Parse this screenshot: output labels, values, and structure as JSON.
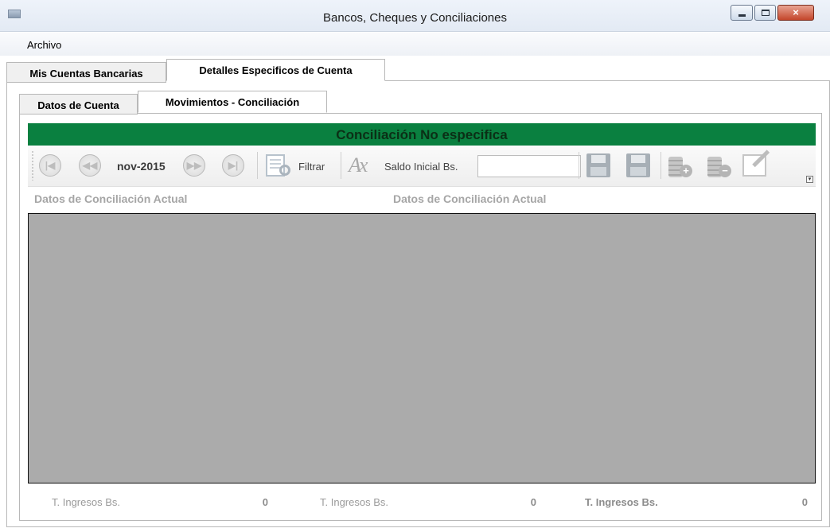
{
  "window": {
    "title": "Bancos, Cheques y Conciliaciones",
    "close_glyph": "×"
  },
  "menu": {
    "items": [
      {
        "label": "Archivo"
      }
    ]
  },
  "outer_tabs": [
    {
      "label": "Mis Cuentas Bancarias",
      "active": false
    },
    {
      "label": "Detalles Especificos de Cuenta",
      "active": true
    }
  ],
  "inner_tabs": [
    {
      "label": "Datos de Cuenta",
      "active": false
    },
    {
      "label": "Movimientos - Conciliación",
      "active": true
    }
  ],
  "header": {
    "title": "Conciliación No especifica",
    "color": "#0a8040"
  },
  "toolbar": {
    "period": "nov-2015",
    "nav_first_glyph": "|◀",
    "nav_prev_glyph": "◀◀",
    "nav_next_glyph": "▶▶",
    "nav_last_glyph": "▶|",
    "filter_label": "Filtrar",
    "ax_glyph": "Ax",
    "saldo_label": "Saldo Inicial Bs.",
    "saldo_value": "",
    "disk_x_glyph": "x",
    "add_glyph": "+",
    "remove_glyph": "−",
    "overflow_glyph": "▾"
  },
  "sections": {
    "left_title": "Datos de Conciliación Actual",
    "right_title": "Datos de Conciliación Actual"
  },
  "totals": [
    {
      "label": "T. Ingresos Bs.",
      "value": "0"
    },
    {
      "label": "T. Ingresos Bs.",
      "value": "0"
    },
    {
      "label": "T. Ingresos Bs.",
      "value": "0"
    }
  ]
}
